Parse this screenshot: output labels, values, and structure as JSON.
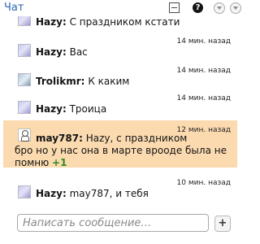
{
  "header": {
    "title": "Чат",
    "icons": [
      "window-icon",
      "help-icon",
      "menu-down-icon",
      "menu-down-icon"
    ]
  },
  "messages": [
    {
      "author": "Hazy",
      "text": "С праздником кстати",
      "time": ""
    },
    {
      "author": "Hazy",
      "text": "Вас",
      "time": "14 мин. назад"
    },
    {
      "author": "Trolikmr",
      "text": "К каким",
      "time": "14 мин. назад"
    },
    {
      "author": "Hazy",
      "text": "Троица",
      "time": "14 мин. назад"
    },
    {
      "author": "may787",
      "lines": [
        "Hazy, с праздником",
        "бро но у нас она в марте врооде была не",
        "помню"
      ],
      "reaction": "+1",
      "time": "12 мин. назад",
      "highlight_color": "#fbdab0"
    },
    {
      "author": "Hazy",
      "text": "may787, и тебя",
      "time": "10 мин. назад"
    }
  ],
  "composer": {
    "placeholder": "Написать сообщение…",
    "send_label": "+"
  },
  "colors": {
    "title": "#2c67b0",
    "highlight": "#fbdab0",
    "reaction": "#2e8b1e"
  }
}
